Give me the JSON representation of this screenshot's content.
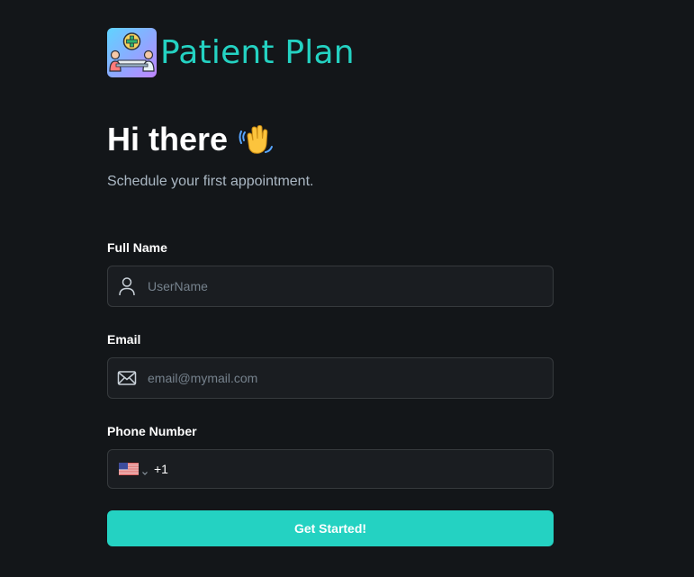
{
  "brand": {
    "name": "Patient Plan",
    "logo_icon": "doctor-patient-consultation-icon",
    "accent_color": "#24d2c2"
  },
  "hero": {
    "title": "Hi there",
    "emoji_icon": "waving-hand-icon",
    "subtitle": "Schedule your first appointment."
  },
  "form": {
    "full_name": {
      "label": "Full Name",
      "placeholder": "UserName",
      "value": "",
      "icon": "user-icon"
    },
    "email": {
      "label": "Email",
      "placeholder": "email@mymail.com",
      "value": "",
      "icon": "envelope-icon"
    },
    "phone": {
      "label": "Phone Number",
      "country_icon": "us-flag-icon",
      "dial_code": "+1",
      "value": ""
    },
    "submit_label": "Get Started!"
  }
}
